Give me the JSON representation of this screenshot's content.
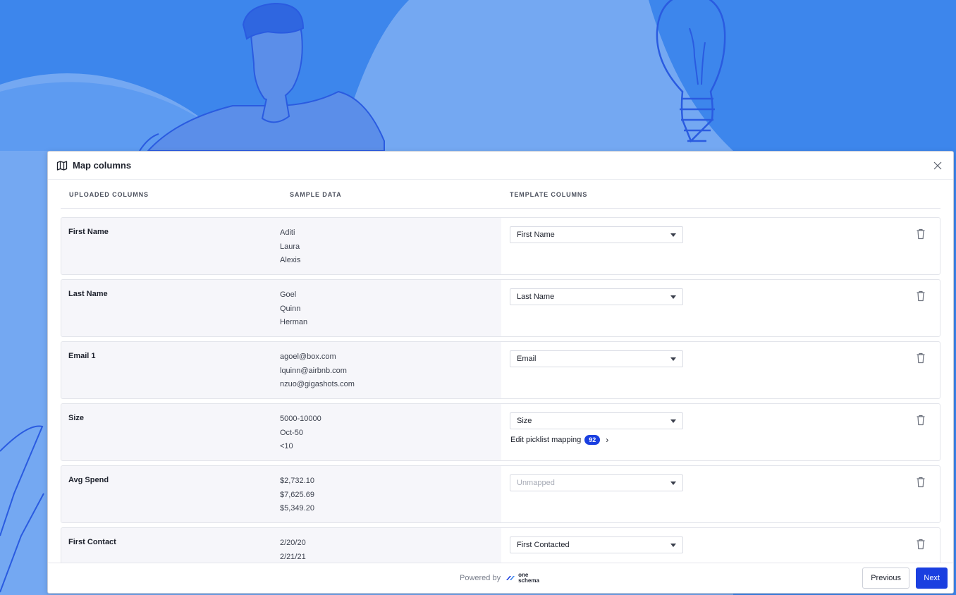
{
  "modal": {
    "title": "Map columns",
    "headers": {
      "uploaded": "UPLOADED COLUMNS",
      "sample": "SAMPLE DATA",
      "template": "TEMPLATE COLUMNS"
    }
  },
  "rows": [
    {
      "uploaded": "First Name",
      "samples": [
        "Aditi",
        "Laura",
        "Alexis"
      ],
      "template": "First Name"
    },
    {
      "uploaded": "Last Name",
      "samples": [
        "Goel",
        "Quinn",
        "Herman"
      ],
      "template": "Last Name"
    },
    {
      "uploaded": "Email 1",
      "samples": [
        "agoel@box.com",
        "lquinn@airbnb.com",
        "nzuo@gigashots.com"
      ],
      "template": "Email"
    },
    {
      "uploaded": "Size",
      "samples": [
        "5000-10000",
        "Oct-50",
        "<10"
      ],
      "template": "Size",
      "picklist_label": "Edit picklist mapping",
      "picklist_count": "92"
    },
    {
      "uploaded": "Avg Spend",
      "samples": [
        "$2,732.10",
        "$7,625.69",
        "$5,349.20"
      ],
      "template": "Unmapped"
    },
    {
      "uploaded": "First Contact",
      "samples": [
        "2/20/20",
        "2/21/21"
      ],
      "template": "First Contacted"
    }
  ],
  "footer": {
    "powered_by": "Powered by",
    "logo_line1": "one",
    "logo_line2": "schema",
    "previous": "Previous",
    "next": "Next"
  },
  "colors": {
    "accent": "#1a3fe0",
    "background": "#3d86ec"
  }
}
